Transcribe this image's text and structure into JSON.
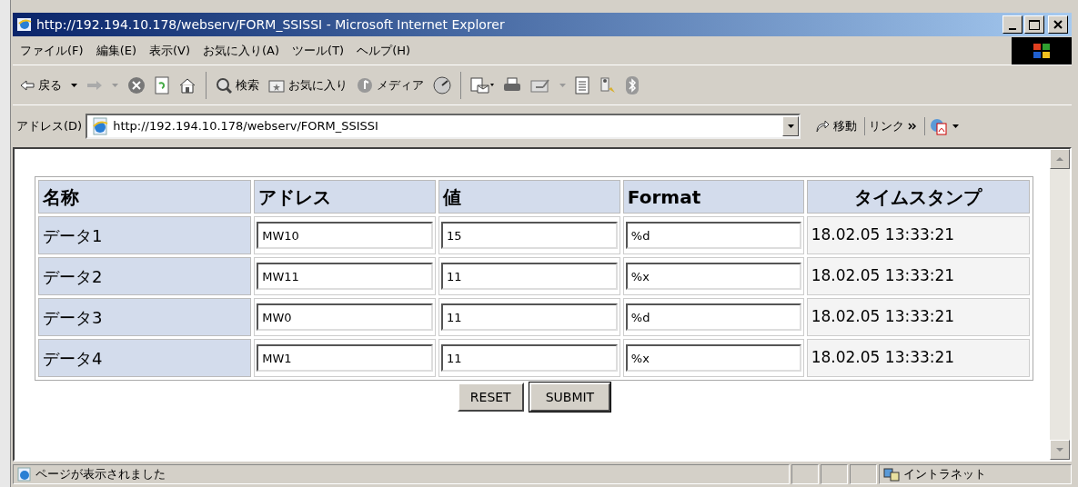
{
  "window": {
    "title": "http://192.194.10.178/webserv/FORM_SSISSI - Microsoft Internet Explorer"
  },
  "menu": [
    "ファイル(F)",
    "編集(E)",
    "表示(V)",
    "お気に入り(A)",
    "ツール(T)",
    "ヘルプ(H)"
  ],
  "toolbar": {
    "back": "戻る",
    "search": "検索",
    "favorites": "お気に入り",
    "media": "メディア"
  },
  "address_bar": {
    "label": "アドレス(D)",
    "url": "http://192.194.10.178/webserv/FORM_SSISSI",
    "go": "移動",
    "links": "リンク"
  },
  "table": {
    "columns": [
      "名称",
      "アドレス",
      "値",
      "Format",
      "タイムスタンプ"
    ],
    "rows": [
      {
        "name": "データ1",
        "address": "MW10",
        "value": "15",
        "format": "%d",
        "timestamp": "18.02.05 13:33:21"
      },
      {
        "name": "データ2",
        "address": "MW11",
        "value": "11",
        "format": "%x",
        "timestamp": "18.02.05 13:33:21"
      },
      {
        "name": "データ3",
        "address": "MW0",
        "value": "11",
        "format": "%d",
        "timestamp": "18.02.05 13:33:21"
      },
      {
        "name": "データ4",
        "address": "MW1",
        "value": "11",
        "format": "%x",
        "timestamp": "18.02.05 13:33:21"
      }
    ]
  },
  "buttons": [
    "RESET",
    "SUBMIT"
  ],
  "status_bar": {
    "message": "ページが表示されました",
    "zone": "イントラネット"
  }
}
